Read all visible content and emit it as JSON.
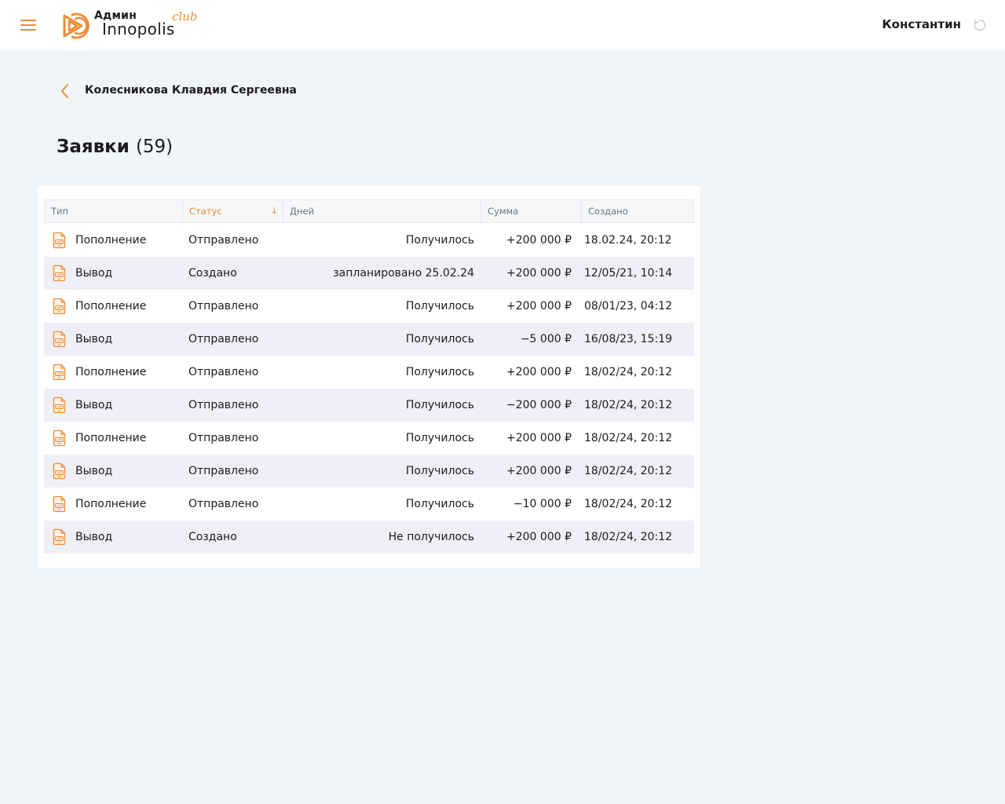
{
  "header": {
    "logo_admin": "Админ",
    "logo_name": "Innopolis",
    "logo_club": "club",
    "user_name": "Константин",
    "accent_color": "#ee8a34"
  },
  "breadcrumb": {
    "back_icon": "chevron-left-icon",
    "title": "Колесникова Клавдия Сергеевна"
  },
  "page": {
    "title": "Заявки",
    "count": "(59)"
  },
  "table": {
    "columns": {
      "type": "Тип",
      "status": "Статус",
      "days": "Дней",
      "amount": "Сумма",
      "created": "Создано"
    },
    "sorted_by": "status",
    "sort_direction": "descending",
    "rows": [
      {
        "type": "Пополнение",
        "status": "Отправлено",
        "days": "Получилось",
        "amount": "+200 000 ₽",
        "created": "18.02.24, 20:12"
      },
      {
        "type": "Вывод",
        "status": "Создано",
        "days": "запланировано 25.02.24",
        "amount": "+200 000 ₽",
        "created": "12/05/21, 10:14"
      },
      {
        "type": "Пополнение",
        "status": "Отправлено",
        "days": "Получилось",
        "amount": "+200 000 ₽",
        "created": "08/01/23, 04:12"
      },
      {
        "type": "Вывод",
        "status": "Отправлено",
        "days": "Получилось",
        "amount": "−5 000 ₽",
        "created": "16/08/23, 15:19"
      },
      {
        "type": "Пополнение",
        "status": "Отправлено",
        "days": "Получилось",
        "amount": "+200 000 ₽",
        "created": "18/02/24, 20:12"
      },
      {
        "type": "Вывод",
        "status": "Отправлено",
        "days": "Получилось",
        "amount": "−200 000 ₽",
        "created": "18/02/24, 20:12"
      },
      {
        "type": "Пополнение",
        "status": "Отправлено",
        "days": "Получилось",
        "amount": "+200 000 ₽",
        "created": "18/02/24, 20:12"
      },
      {
        "type": "Вывод",
        "status": "Отправлено",
        "days": "Получилось",
        "amount": "+200 000 ₽",
        "created": "18/02/24, 20:12"
      },
      {
        "type": "Пополнение",
        "status": "Отправлено",
        "days": "Получилось",
        "amount": "−10 000 ₽",
        "created": "18/02/24, 20:12"
      },
      {
        "type": "Вывод",
        "status": "Создано",
        "days": "Не получилось",
        "amount": "+200 000 ₽",
        "created": "18/02/24, 20:12"
      }
    ]
  }
}
